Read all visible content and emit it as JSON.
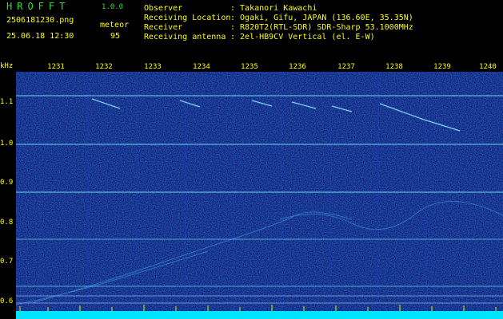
{
  "header": {
    "logo": "HROFFT",
    "version": "1.0.0",
    "filename": "2506181230.png",
    "mode": "meteor",
    "datetime": "25.06.18 12:30",
    "count": "95",
    "rows": [
      {
        "label": "Observer",
        "value": ": Takanori Kawachi"
      },
      {
        "label": "Receiving Location",
        "value": ": Ogaki, Gifu, JAPAN (136.60E, 35.35N)"
      },
      {
        "label": "Receiver",
        "value": ": R820T2(RTL-SDR) SDR-Sharp 53.1000MHz"
      },
      {
        "label": "Receiving antenna",
        "value": ": 2el-HB9CV Vertical (el. E-W)"
      }
    ]
  },
  "axis": {
    "unit": "kHz",
    "x_ticks": [
      "1231",
      "1232",
      "1233",
      "1234",
      "1235",
      "1236",
      "1237",
      "1238",
      "1239",
      "1240"
    ],
    "y_ticks": [
      "1.1",
      "1.0",
      "0.9",
      "0.8",
      "0.7",
      "0.6"
    ]
  },
  "colors": {
    "background": "#000000",
    "noise": "#0a1e9a",
    "trace": "#55ddff",
    "text_green": "#33dd33",
    "text_yellow": "#ffff00"
  }
}
